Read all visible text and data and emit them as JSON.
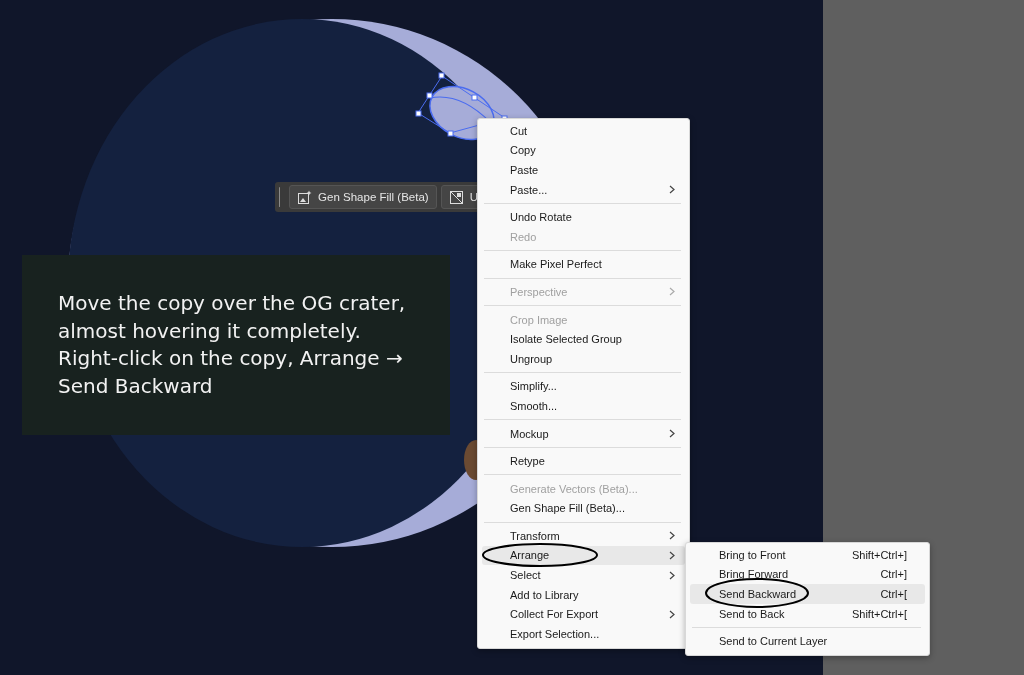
{
  "toolbar": {
    "buttons": [
      {
        "label": "Gen Shape Fill (Beta)",
        "kind": "gen-fill"
      },
      {
        "label": "U",
        "kind": "image"
      }
    ]
  },
  "caption": "Move the copy over the OG crater, almost hovering it completely. Right-click on the copy, Arrange → Send Backward",
  "context_menu": {
    "groups": [
      [
        {
          "label": "Cut",
          "disabled": false,
          "has_submenu": false,
          "selected": false
        },
        {
          "label": "Copy",
          "disabled": false,
          "has_submenu": false,
          "selected": false
        },
        {
          "label": "Paste",
          "disabled": false,
          "has_submenu": false,
          "selected": false
        },
        {
          "label": "Paste...",
          "disabled": false,
          "has_submenu": true,
          "selected": false
        }
      ],
      [
        {
          "label": "Undo Rotate",
          "disabled": false,
          "has_submenu": false,
          "selected": false
        },
        {
          "label": "Redo",
          "disabled": true,
          "has_submenu": false,
          "selected": false
        }
      ],
      [
        {
          "label": "Make Pixel Perfect",
          "disabled": false,
          "has_submenu": false,
          "selected": false
        }
      ],
      [
        {
          "label": "Perspective",
          "disabled": true,
          "has_submenu": true,
          "selected": false
        }
      ],
      [
        {
          "label": "Crop Image",
          "disabled": true,
          "has_submenu": false,
          "selected": false
        },
        {
          "label": "Isolate Selected Group",
          "disabled": false,
          "has_submenu": false,
          "selected": false
        },
        {
          "label": "Ungroup",
          "disabled": false,
          "has_submenu": false,
          "selected": false
        }
      ],
      [
        {
          "label": "Simplify...",
          "disabled": false,
          "has_submenu": false,
          "selected": false
        },
        {
          "label": "Smooth...",
          "disabled": false,
          "has_submenu": false,
          "selected": false
        }
      ],
      [
        {
          "label": "Mockup",
          "disabled": false,
          "has_submenu": true,
          "selected": false
        }
      ],
      [
        {
          "label": "Retype",
          "disabled": false,
          "has_submenu": false,
          "selected": false
        }
      ],
      [
        {
          "label": "Generate Vectors (Beta)...",
          "disabled": true,
          "has_submenu": false,
          "selected": false
        },
        {
          "label": "Gen Shape Fill (Beta)...",
          "disabled": false,
          "has_submenu": false,
          "selected": false
        }
      ],
      [
        {
          "label": "Transform",
          "disabled": false,
          "has_submenu": true,
          "selected": false
        },
        {
          "label": "Arrange",
          "disabled": false,
          "has_submenu": true,
          "selected": true
        },
        {
          "label": "Select",
          "disabled": false,
          "has_submenu": true,
          "selected": false
        },
        {
          "label": "Add to Library",
          "disabled": false,
          "has_submenu": false,
          "selected": false
        },
        {
          "label": "Collect For Export",
          "disabled": false,
          "has_submenu": true,
          "selected": false
        },
        {
          "label": "Export Selection...",
          "disabled": false,
          "has_submenu": false,
          "selected": false
        }
      ]
    ]
  },
  "submenu": {
    "groups": [
      [
        {
          "label": "Bring to Front",
          "shortcut": "Shift+Ctrl+]",
          "selected": false
        },
        {
          "label": "Bring Forward",
          "shortcut": "Ctrl+]",
          "selected": false
        },
        {
          "label": "Send Backward",
          "shortcut": "Ctrl+[",
          "selected": true
        },
        {
          "label": "Send to Back",
          "shortcut": "Shift+Ctrl+[",
          "selected": false
        }
      ],
      [
        {
          "label": "Send to Current Layer",
          "selected": false
        }
      ]
    ]
  }
}
